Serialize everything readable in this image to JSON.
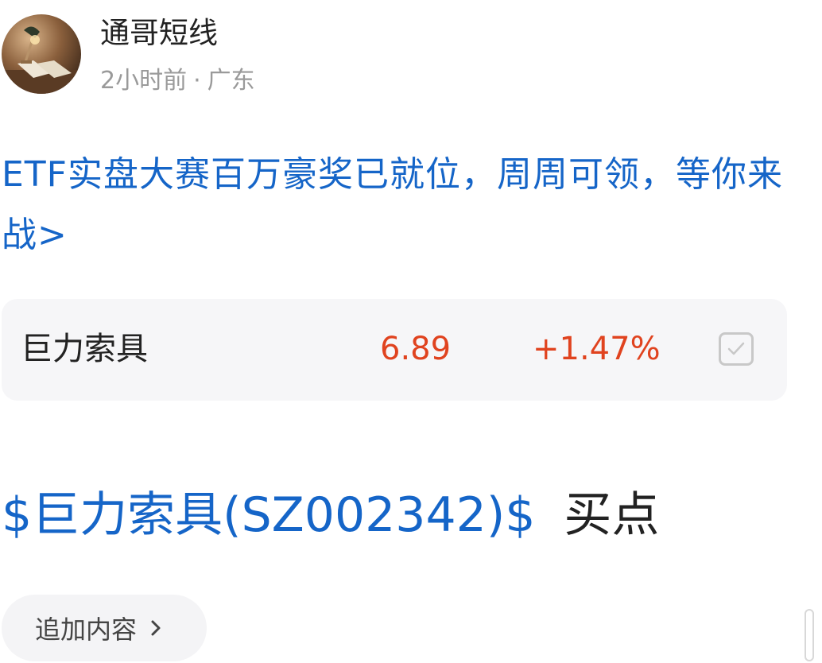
{
  "post": {
    "author": {
      "name": "通哥短线",
      "avatar_icon": "desk-lamp-photo-avatar"
    },
    "time": "2小时前",
    "separator": "·",
    "location": "广东",
    "promo_text": "ETF实盘大赛百万豪奖已就位，周周可领，等你来战>",
    "stock_card": {
      "name": "巨力索具",
      "price": "6.89",
      "change": "+1.47%",
      "price_color": "#e0431f",
      "check_icon": "checkbox-check-icon"
    },
    "title": {
      "stock_tag": "$巨力索具(SZ002342)$",
      "text": "买点"
    },
    "add_content_label": "追加内容",
    "add_content_icon": "chevron-right-icon"
  },
  "colors": {
    "link_blue": "#1565c8",
    "up_red": "#e0431f",
    "muted_gray": "#9a9a9a",
    "card_bg": "#f6f6f8"
  }
}
